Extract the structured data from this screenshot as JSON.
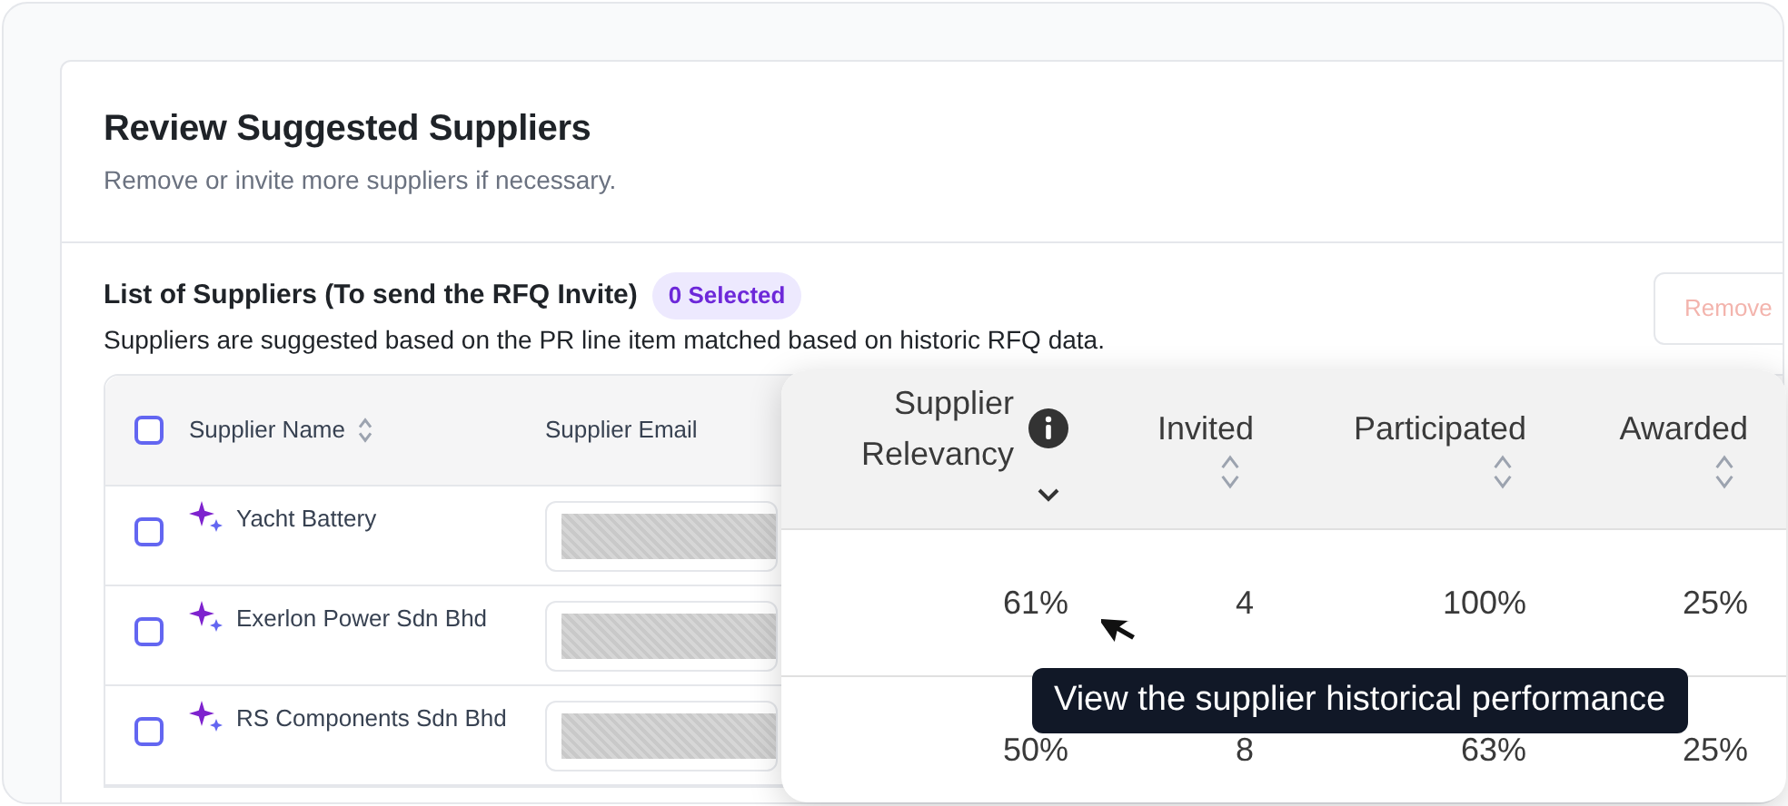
{
  "header": {
    "title": "Review Suggested Suppliers",
    "subtitle": "Remove or invite more suppliers if necessary."
  },
  "list": {
    "title": "List of Suppliers (To send the RFQ Invite)",
    "badge": "0 Selected",
    "description": "Suppliers are suggested based on the PR line item matched based on historic RFQ data.",
    "remove_button": {
      "label": "Remove",
      "disabled": true
    }
  },
  "table": {
    "select_all": {
      "checked": false
    },
    "columns": [
      {
        "label": "Supplier Name",
        "sortable": true
      },
      {
        "label": "Supplier Email",
        "sortable": false
      }
    ],
    "rows": [
      {
        "name": "Yacht Battery",
        "checked": false,
        "suggested": true
      },
      {
        "name": "Exerlon Power Sdn Bhd",
        "checked": false,
        "suggested": true
      },
      {
        "name": "RS Components Sdn Bhd",
        "checked": false,
        "suggested": true
      }
    ]
  },
  "performance_popout": {
    "columns": [
      {
        "label": "Supplier Relevancy",
        "info": true,
        "sorted_descending": true
      },
      {
        "label": "Invited",
        "info": false,
        "sorted_descending": false
      },
      {
        "label": "Participated",
        "info": false,
        "sorted_descending": false
      },
      {
        "label": "Awarded",
        "info": false,
        "sorted_descending": false
      }
    ],
    "rows": [
      [
        "61%",
        "4",
        "100%",
        "25%"
      ],
      [
        "50%",
        "8",
        "63%",
        "25%"
      ]
    ]
  },
  "tooltip": {
    "text": "View the supplier historical performance"
  }
}
